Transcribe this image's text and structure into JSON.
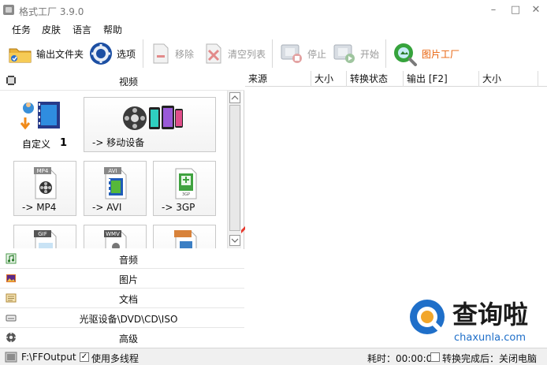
{
  "window": {
    "title": "格式工厂 3.9.0",
    "min": "–",
    "max": "□",
    "close": "✕"
  },
  "menu": [
    "任务",
    "皮肤",
    "语言",
    "帮助"
  ],
  "toolbar": {
    "output_folder": "输出文件夹",
    "options": "选项",
    "remove": "移除",
    "clear_list": "清空列表",
    "stop": "停止",
    "start": "开始",
    "picture_factory": "图片工厂"
  },
  "left": {
    "video_header": "视频",
    "tiles": {
      "custom": "自定义",
      "custom_num": "1",
      "mobile": "-> 移动设备",
      "mp4": "-> MP4",
      "avi": "-> AVI",
      "3gp": "-> 3GP",
      "mp4_badge": "MP4",
      "avi_badge": "AVI",
      "3gp_badge": "3GP",
      "gif_badge": "GIF",
      "wmv_badge": "WMV"
    },
    "categories": [
      "音频",
      "图片",
      "文档",
      "光驱设备\\DVD\\CD\\ISO",
      "高级"
    ]
  },
  "list": {
    "columns": [
      "来源",
      "大小",
      "转换状态",
      "输出 [F2]",
      "大小"
    ]
  },
  "status": {
    "path": "F:\\FFOutput",
    "multithread_label": "使用多线程",
    "multithread_checked": "✓",
    "elapsed": "耗时：00:00:00",
    "after_label": "转换完成后：关闭电脑"
  },
  "watermark": {
    "brand": "查询啦",
    "url": "chaxunla.com"
  },
  "colors": {
    "accent_orange": "#e8610a",
    "watermark_blue": "#1f6fc9",
    "arrow_red": "#e8382d"
  }
}
